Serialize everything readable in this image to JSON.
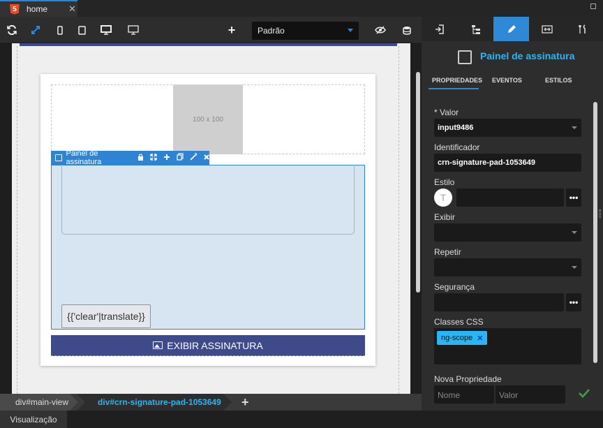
{
  "tab": {
    "label": "home",
    "close": "✕",
    "badge": "5"
  },
  "toolbar": {
    "device_select": "Padrão",
    "icons": [
      "refresh-icon",
      "expand-icon",
      "phone-icon",
      "tablet-icon",
      "desktop-icon",
      "monitor-icon",
      "add-icon",
      "eye-slash-icon",
      "database-icon"
    ]
  },
  "canvas": {
    "image_placeholder": "100 x 100",
    "component_toolbar": {
      "label": "Painel de assinatura"
    },
    "clear_button": "{{'clear'|translate}}",
    "show_signature_button": "EXIBIR ASSINATURA"
  },
  "breadcrumb": {
    "items": [
      "div#main-view",
      "div#crn-signature-pad-1053649"
    ],
    "add": "+"
  },
  "bottom_tab": "Visualização",
  "panel": {
    "title": "Painel de assinatura",
    "subtabs": [
      "PROPRIEDADES",
      "EVENTOS",
      "ESTILOS"
    ],
    "fields": {
      "valor_label": "* Valor",
      "valor_value": "input9486",
      "identificador_label": "Identificador",
      "identificador_value": "crn-signature-pad-1053649",
      "estilo_label": "Estilo",
      "estilo_circle": "T",
      "exibir_label": "Exibir",
      "repetir_label": "Repetir",
      "seguranca_label": "Segurança",
      "classes_label": "Classes CSS",
      "classes_chip": "ng-scope",
      "nova_label": "Nova Propriedade",
      "nome_placeholder": "Nome",
      "valor_placeholder": "Valor",
      "more_dots": "•••"
    }
  },
  "colors": {
    "accent": "#2e8ad6",
    "title_blue": "#29b6f6",
    "button_indigo": "#3f4a8a",
    "panel_bg": "#d7e4f1"
  }
}
